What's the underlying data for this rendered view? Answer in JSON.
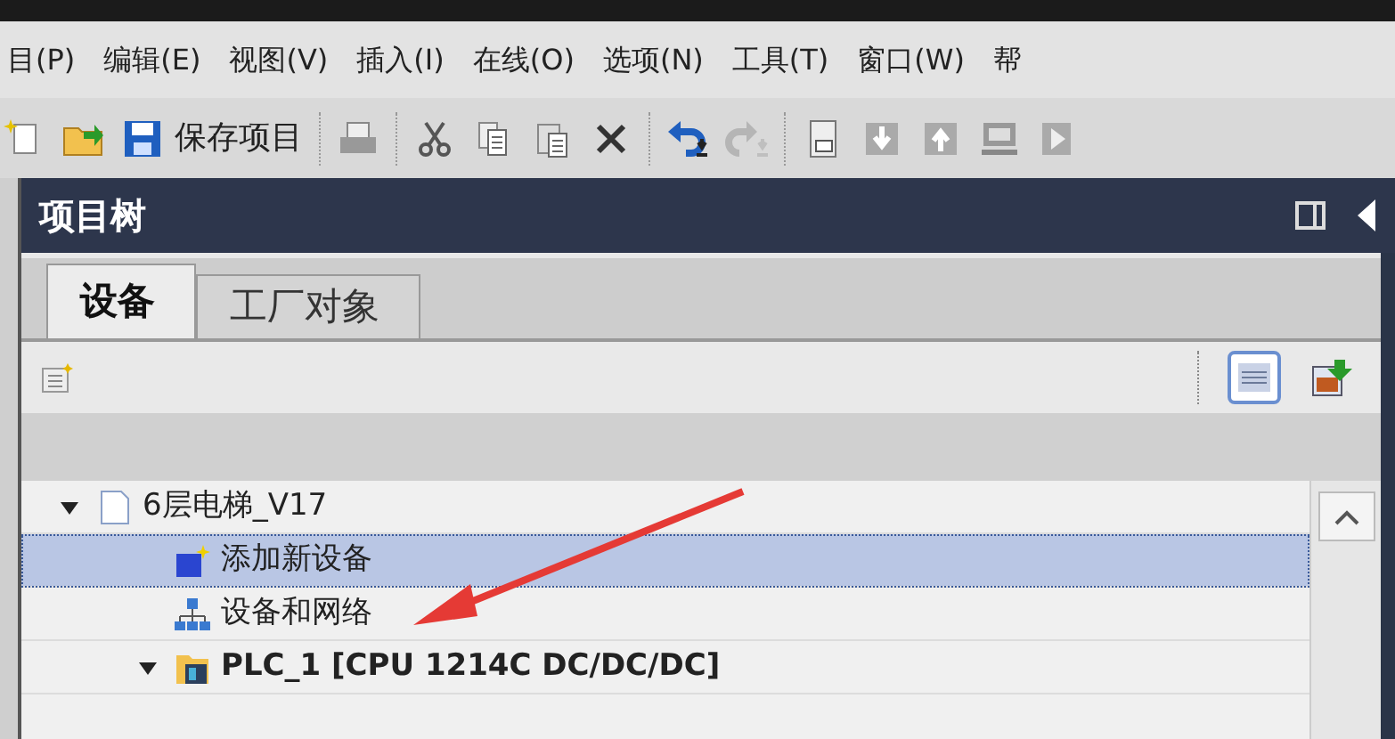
{
  "menu": [
    {
      "label": "目(P)"
    },
    {
      "label": "编辑(E)"
    },
    {
      "label": "视图(V)"
    },
    {
      "label": "插入(I)"
    },
    {
      "label": "在线(O)"
    },
    {
      "label": "选项(N)"
    },
    {
      "label": "工具(T)"
    },
    {
      "label": "窗口(W)"
    },
    {
      "label": "帮"
    }
  ],
  "toolbar": [
    {
      "kind": "new"
    },
    {
      "kind": "open"
    },
    {
      "kind": "save",
      "label": "保存项目"
    },
    {
      "kind": "sep"
    },
    {
      "kind": "print"
    },
    {
      "kind": "sep"
    },
    {
      "kind": "cut"
    },
    {
      "kind": "copy"
    },
    {
      "kind": "paste"
    },
    {
      "kind": "delete"
    },
    {
      "kind": "sep"
    },
    {
      "kind": "undo"
    },
    {
      "kind": "redo",
      "disabled": true
    },
    {
      "kind": "sep"
    },
    {
      "kind": "compile"
    },
    {
      "kind": "download"
    },
    {
      "kind": "upload"
    },
    {
      "kind": "monitor"
    },
    {
      "kind": "simulate"
    }
  ],
  "panel": {
    "title": "项目树"
  },
  "tabs": [
    {
      "label": "设备",
      "selected": true
    },
    {
      "label": "工厂对象",
      "selected": false
    }
  ],
  "tree": [
    {
      "label": "6层电梯_V17",
      "kind": "project",
      "expanded": true,
      "selected": false,
      "children": [
        {
          "label": "添加新设备",
          "kind": "add-device",
          "selected": true
        },
        {
          "label": "设备和网络",
          "kind": "network",
          "selected": false
        },
        {
          "label": "PLC_1 [CPU 1214C DC/DC/DC]",
          "kind": "plc",
          "expanded": true,
          "selected": false
        }
      ]
    }
  ]
}
